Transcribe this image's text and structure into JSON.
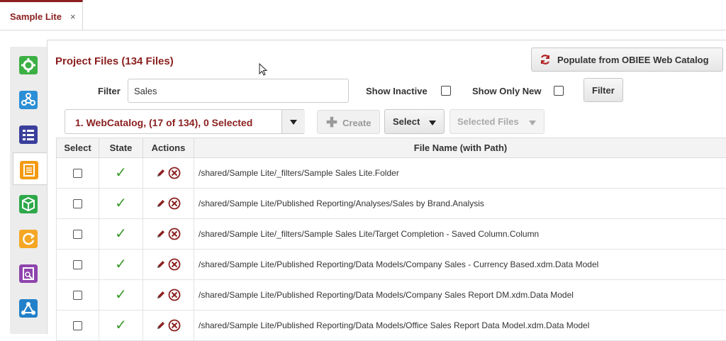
{
  "tab": {
    "label": "Sample Lite",
    "close": "×"
  },
  "sidebar": {
    "items": [
      {
        "icon": "gear-icon",
        "color": "#3cb045"
      },
      {
        "icon": "network-icon",
        "color": "#2c8fd6"
      },
      {
        "icon": "list-icon",
        "color": "#3a3f9c"
      },
      {
        "icon": "document-icon",
        "color": "#f39a12"
      },
      {
        "icon": "cube-icon",
        "color": "#2ea84a"
      },
      {
        "icon": "refresh-icon",
        "color": "#f5a623"
      },
      {
        "icon": "report-icon",
        "color": "#8e44ad"
      },
      {
        "icon": "share-icon",
        "color": "#2280c9"
      }
    ]
  },
  "main": {
    "title": "Project Files (134 Files)",
    "populate_label": "Populate from OBIEE Web Catalog",
    "filter": {
      "label": "Filter",
      "value": "Sales"
    },
    "show_inactive": "Show Inactive",
    "show_only_new": "Show Only New",
    "filter_button": "Filter",
    "catalog_select": "1. WebCatalog, (17 of 134), 0 Selected",
    "create_label": "Create",
    "select_label": "Select",
    "selected_files_label": "Selected Files",
    "columns": [
      "Select",
      "State",
      "Actions",
      "File Name (with Path)"
    ],
    "rows": [
      {
        "file": "/shared/Sample Lite/_filters/Sample Sales Lite.Folder"
      },
      {
        "file": "/shared/Sample Lite/Published Reporting/Analyses/Sales by Brand.Analysis"
      },
      {
        "file": "/shared/Sample Lite/_filters/Sample Sales Lite/Target Completion - Saved Column.Column"
      },
      {
        "file": "/shared/Sample Lite/Published Reporting/Data Models/Company Sales - Currency Based.xdm.Data Model"
      },
      {
        "file": "/shared/Sample Lite/Published Reporting/Data Models/Company Sales Report DM.xdm.Data Model"
      },
      {
        "file": "/shared/Sample Lite/Published Reporting/Data Models/Office Sales Report Data Model.xdm.Data Model"
      }
    ]
  },
  "colors": {
    "accent": "#8b1f1f",
    "check": "#3a9a2a"
  }
}
